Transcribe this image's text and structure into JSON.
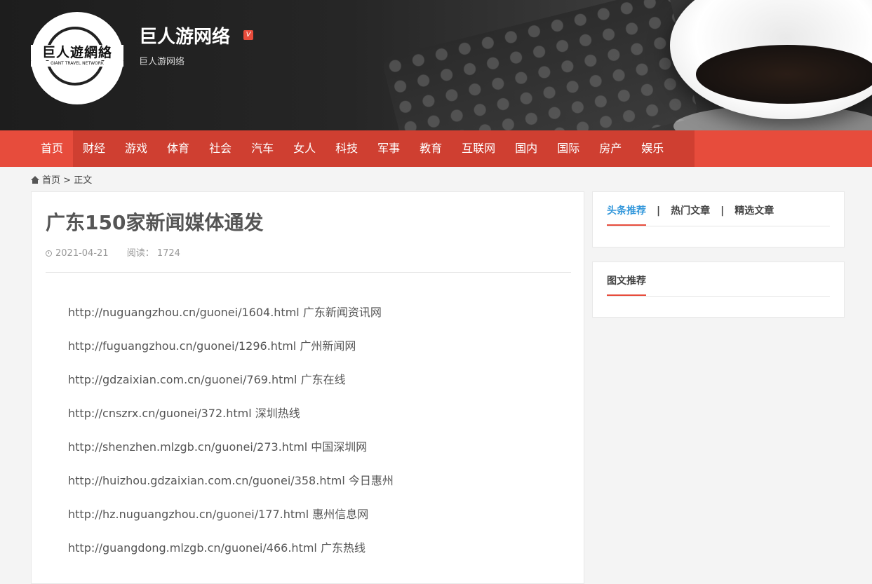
{
  "header": {
    "logo_text": "巨人遊網絡",
    "logo_subtext": "GIANT TRAVEL NETWORK",
    "site_title": "巨人游网络",
    "verified_badge": "V",
    "site_subtitle": "巨人游网络"
  },
  "nav": {
    "items": [
      "首页",
      "财经",
      "游戏",
      "体育",
      "社会",
      "汽车",
      "女人",
      "科技",
      "军事",
      "教育",
      "互联网",
      "国内",
      "国际",
      "房产",
      "娱乐"
    ],
    "active_index": 0
  },
  "breadcrumb": {
    "home": "首页",
    "separator": ">",
    "current": "正文"
  },
  "article": {
    "title": "广东150家新闻媒体通发",
    "date": "2021-04-21",
    "views_label": "阅读：",
    "views": "1724",
    "links": [
      "http://nuguangzhou.cn/guonei/1604.html 广东新闻资讯网",
      "http://fuguangzhou.cn/guonei/1296.html 广州新闻网",
      "http://gdzaixian.com.cn/guonei/769.html 广东在线",
      "http://cnszrx.cn/guonei/372.html 深圳热线",
      "http://shenzhen.mlzgb.cn/guonei/273.html 中国深圳网",
      "http://huizhou.gdzaixian.com.cn/guonei/358.html 今日惠州",
      "http://hz.nuguangzhou.cn/guonei/177.html 惠州信息网",
      "http://guangdong.mlzgb.cn/guonei/466.html 广东热线"
    ]
  },
  "sidebar": {
    "tabs": [
      "头条推荐",
      "热门文章",
      "精选文章"
    ],
    "tab_separator": "|",
    "photo_title": "图文推荐"
  },
  "colors": {
    "accent": "#e74c3c",
    "nav_dark": "#cf3f31",
    "tab_active": "#3498db"
  },
  "icons": {
    "home": "home-icon",
    "clock": "clock-icon"
  }
}
